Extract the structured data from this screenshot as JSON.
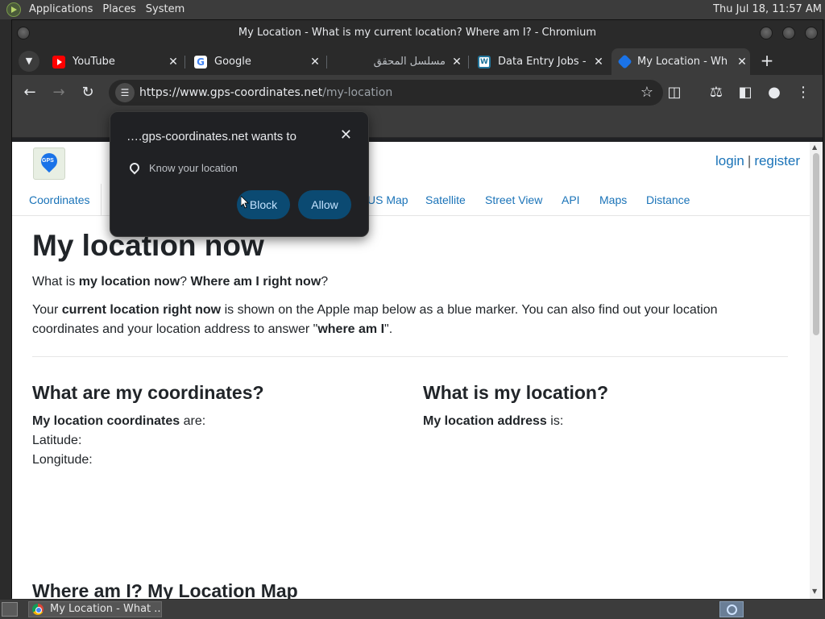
{
  "system_panel": {
    "menus": [
      "Applications",
      "Places",
      "System"
    ],
    "clock": "Thu Jul 18, 11:57 AM"
  },
  "window": {
    "title": "My Location - What is my current location? Where am I? - Chromium"
  },
  "tabs": [
    {
      "title": "YouTube",
      "icon": "youtube-icon"
    },
    {
      "title": "Google",
      "icon": "google-icon"
    },
    {
      "title": "مسلسل المحقق",
      "icon": "blank-icon"
    },
    {
      "title": "Data Entry Jobs - ",
      "icon": "wordpress-icon"
    },
    {
      "title": "My Location - Wh",
      "icon": "gps-icon",
      "active": true
    }
  ],
  "toolbar": {
    "url_host": "https://www.gps-coordinates.net",
    "url_path": "/my-location"
  },
  "site": {
    "auth_login": "login",
    "auth_sep": "|",
    "auth_register": "register",
    "nav": [
      "Coordinates",
      "US Map",
      "Satellite",
      "Street View",
      "API",
      "Maps",
      "Distance"
    ],
    "heading": "My location now",
    "q_part1": "What is ",
    "q_b1": "my location now",
    "q_part2": "? ",
    "q_b2": "Where am I right now",
    "q_part3": "?",
    "d_part1": "Your ",
    "d_b1": "current location right now",
    "d_part2": " is shown on the Apple map below as a blue marker. You can also find out your location coordinates and your location address to answer \"",
    "d_b2": "where am I",
    "d_part3": "\".",
    "coords_heading": "What are my coordinates?",
    "coords_b": "My location coordinates",
    "coords_rest": " are:",
    "latitude_label": "Latitude:",
    "longitude_label": "Longitude:",
    "location_heading": "What is my location?",
    "address_b": "My location address",
    "address_rest": " is:",
    "map_heading": "Where am I? My Location Map"
  },
  "permission_prompt": {
    "title": "….gps-coordinates.net wants to",
    "permission": "Know your location",
    "block_label": "Block",
    "allow_label": "Allow"
  },
  "taskbar": {
    "task_title": "My Location - What ..."
  },
  "colors": {
    "link": "#1a73b8",
    "prompt_button": "#0b4a72",
    "chrome_dark": "#202124"
  }
}
